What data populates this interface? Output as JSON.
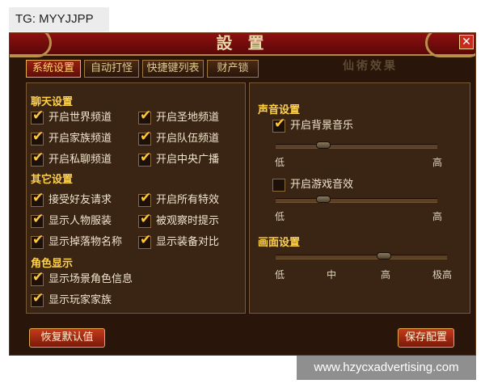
{
  "watermarks": {
    "top_left": "TG: MYYJJPP",
    "bottom_right": "www.hzycxadvertising.com"
  },
  "window": {
    "title": "設 置",
    "close_icon": "close-icon",
    "ghost_text": "仙術效果"
  },
  "tabs": [
    {
      "label": "系统设置",
      "active": true
    },
    {
      "label": "自动打怪",
      "active": false
    },
    {
      "label": "快捷键列表",
      "active": false
    },
    {
      "label": "财产锁",
      "active": false
    }
  ],
  "chat_settings": {
    "title": "聊天设置",
    "options": [
      {
        "label": "开启世界频道",
        "checked": true
      },
      {
        "label": "开启圣地频道",
        "checked": true
      },
      {
        "label": "开启家族频道",
        "checked": true
      },
      {
        "label": "开启队伍频道",
        "checked": true
      },
      {
        "label": "开启私聊频道",
        "checked": true
      },
      {
        "label": "开启中央广播",
        "checked": true
      }
    ]
  },
  "other_settings": {
    "title": "其它设置",
    "options": [
      {
        "label": "接受好友请求",
        "checked": true
      },
      {
        "label": "开启所有特效",
        "checked": true
      },
      {
        "label": "显示人物服装",
        "checked": true
      },
      {
        "label": "被观察时提示",
        "checked": true
      },
      {
        "label": "显示掉落物名称",
        "checked": true
      },
      {
        "label": "显示装备对比",
        "checked": true
      }
    ]
  },
  "role_display": {
    "title": "角色显示",
    "options": [
      {
        "label": "显示场景角色信息",
        "checked": true
      },
      {
        "label": "显示玩家家族",
        "checked": true
      }
    ]
  },
  "sound_settings": {
    "title": "声音设置",
    "music": {
      "label": "开启背景音乐",
      "checked": true,
      "level": 0.3,
      "low": "低",
      "high": "高"
    },
    "effects": {
      "label": "开启游戏音效",
      "checked": false,
      "level": 0.3,
      "low": "低",
      "high": "高"
    }
  },
  "graphics_settings": {
    "title": "画面设置",
    "ticks": [
      "低",
      "中",
      "高",
      "极高"
    ],
    "level": "高"
  },
  "buttons": {
    "restore_defaults": "恢复默认值",
    "save_config": "保存配置"
  },
  "colors": {
    "accent_gold": "#ffd24a",
    "check_gold": "#ffc838",
    "window_bg": "#2a150a",
    "title_red": "#8e1010"
  }
}
